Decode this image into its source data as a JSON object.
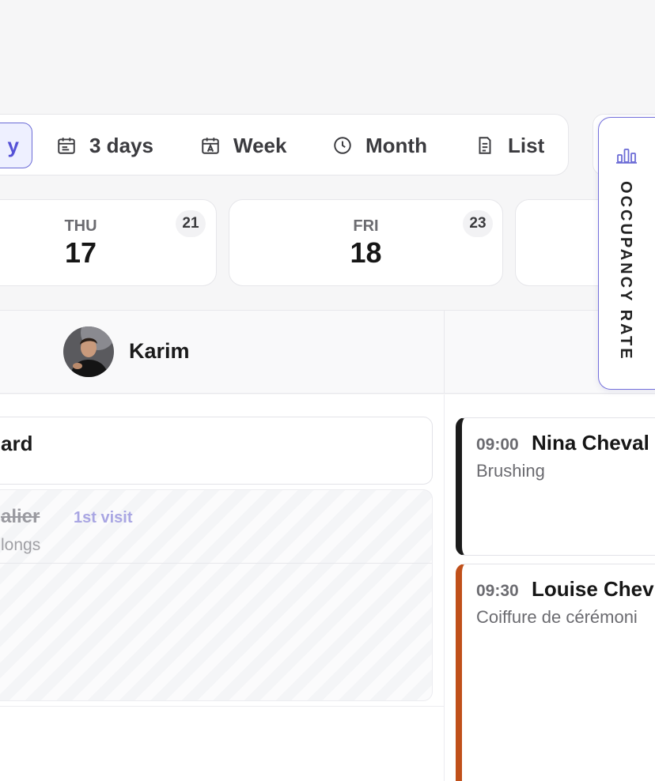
{
  "views": {
    "active": {
      "label": "Day",
      "visible_text": "y"
    },
    "items": [
      {
        "label": "3 days",
        "icon": "calendar-lines-icon"
      },
      {
        "label": "Week",
        "icon": "calendar-week-icon"
      },
      {
        "label": "Month",
        "icon": "clock-icon"
      },
      {
        "label": "List",
        "icon": "list-doc-icon"
      }
    ]
  },
  "days": [
    {
      "dow": "THU",
      "num": "17",
      "count": "21"
    },
    {
      "dow": "FRI",
      "num": "18",
      "count": "23"
    }
  ],
  "staff": {
    "name": "Karim"
  },
  "appointments_left": [
    {
      "name": "ard"
    },
    {
      "name": "alier",
      "tag": "1st visit",
      "service": "longs"
    }
  ],
  "appointments_right": [
    {
      "time": "09:00",
      "client": "Nina Cheval",
      "service": "Brushing"
    },
    {
      "time": "09:30",
      "client": "Louise Chev",
      "service": "Coiffure de cérémoni"
    }
  ],
  "occupancy": {
    "label": "OCCUPANCY RATE",
    "icon": "bar-chart-icon",
    "accent": "#7470dc"
  },
  "colors": {
    "accent": "#5551d6",
    "dark_strip": "#1b1b1b",
    "orange_strip": "#c0501a"
  }
}
